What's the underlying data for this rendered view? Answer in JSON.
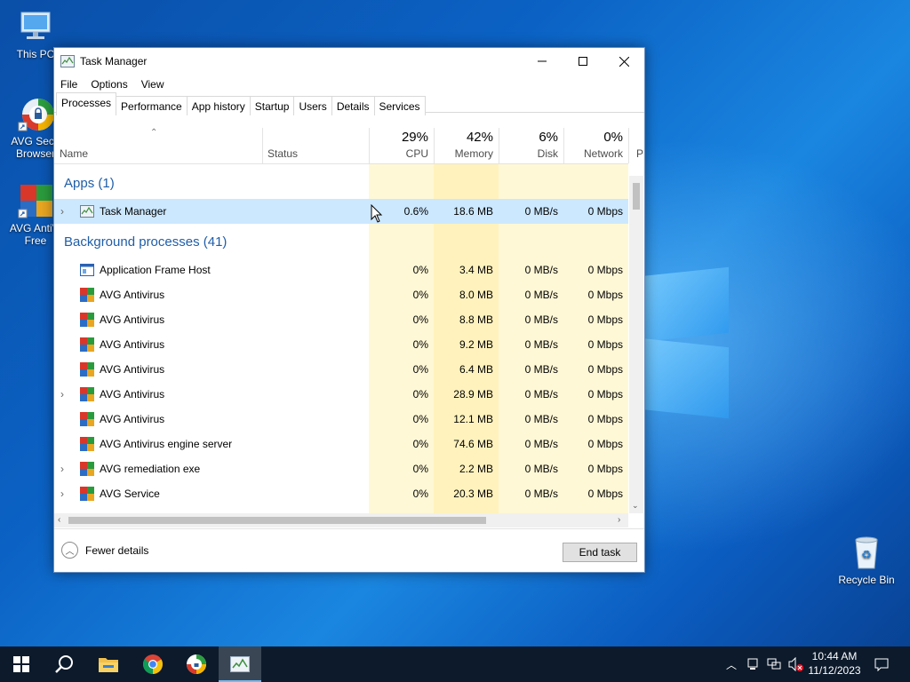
{
  "desktop": {
    "icons": [
      {
        "label": "This PC"
      },
      {
        "label": "AVG Secure Browser",
        "line1": "AVG Secu",
        "line2": "Browser"
      },
      {
        "label": "AVG AntiVirus Free",
        "line1": "AVG AntiVi",
        "line2": "Free"
      },
      {
        "label": "Recycle Bin"
      }
    ]
  },
  "window": {
    "title": "Task Manager",
    "menu": [
      "File",
      "Options",
      "View"
    ],
    "tabs": [
      "Processes",
      "Performance",
      "App history",
      "Startup",
      "Users",
      "Details",
      "Services"
    ],
    "active_tab": "Processes"
  },
  "columns": {
    "name": "Name",
    "status": "Status",
    "cpu": {
      "pct": "29%",
      "label": "CPU"
    },
    "memory": {
      "pct": "42%",
      "label": "Memory"
    },
    "disk": {
      "pct": "6%",
      "label": "Disk"
    },
    "network": {
      "pct": "0%",
      "label": "Network"
    },
    "power_partial": "P"
  },
  "groups": {
    "apps": "Apps (1)",
    "background": "Background processes (41)"
  },
  "apps": [
    {
      "name": "Task Manager",
      "cpu": "0.6%",
      "memory": "18.6 MB",
      "disk": "0 MB/s",
      "network": "0 Mbps",
      "expandable": true,
      "icon": "task-manager-icon"
    }
  ],
  "background": [
    {
      "name": "Application Frame Host",
      "cpu": "0%",
      "memory": "3.4 MB",
      "disk": "0 MB/s",
      "network": "0 Mbps",
      "expandable": false,
      "icon": "app-frame-icon"
    },
    {
      "name": "AVG Antivirus",
      "cpu": "0%",
      "memory": "8.0 MB",
      "disk": "0 MB/s",
      "network": "0 Mbps",
      "expandable": false,
      "icon": "avg-icon"
    },
    {
      "name": "AVG Antivirus",
      "cpu": "0%",
      "memory": "8.8 MB",
      "disk": "0 MB/s",
      "network": "0 Mbps",
      "expandable": false,
      "icon": "avg-icon"
    },
    {
      "name": "AVG Antivirus",
      "cpu": "0%",
      "memory": "9.2 MB",
      "disk": "0 MB/s",
      "network": "0 Mbps",
      "expandable": false,
      "icon": "avg-icon"
    },
    {
      "name": "AVG Antivirus",
      "cpu": "0%",
      "memory": "6.4 MB",
      "disk": "0 MB/s",
      "network": "0 Mbps",
      "expandable": false,
      "icon": "avg-icon"
    },
    {
      "name": "AVG Antivirus",
      "cpu": "0%",
      "memory": "28.9 MB",
      "disk": "0 MB/s",
      "network": "0 Mbps",
      "expandable": true,
      "icon": "avg-icon"
    },
    {
      "name": "AVG Antivirus",
      "cpu": "0%",
      "memory": "12.1 MB",
      "disk": "0 MB/s",
      "network": "0 Mbps",
      "expandable": false,
      "icon": "avg-icon"
    },
    {
      "name": "AVG Antivirus engine server",
      "cpu": "0%",
      "memory": "74.6 MB",
      "disk": "0 MB/s",
      "network": "0 Mbps",
      "expandable": false,
      "icon": "avg-icon"
    },
    {
      "name": "AVG remediation exe",
      "cpu": "0%",
      "memory": "2.2 MB",
      "disk": "0 MB/s",
      "network": "0 Mbps",
      "expandable": true,
      "icon": "avg-icon"
    },
    {
      "name": "AVG Service",
      "cpu": "0%",
      "memory": "20.3 MB",
      "disk": "0 MB/s",
      "network": "0 Mbps",
      "expandable": true,
      "icon": "avg-icon"
    }
  ],
  "footer": {
    "fewer_details": "Fewer details",
    "end_task": "End task"
  },
  "taskbar": {
    "time": "10:44 AM",
    "date": "11/12/2023",
    "apps": [
      "start-icon",
      "search-icon",
      "file-explorer-icon",
      "chrome-icon",
      "avg-browser-icon",
      "task-manager-icon"
    ]
  },
  "colors": {
    "selected_row": "#cce8ff",
    "cpu_shade": "#fff4c4",
    "memory_shade": "#ffefb0",
    "group_text": "#1f5ea8"
  }
}
